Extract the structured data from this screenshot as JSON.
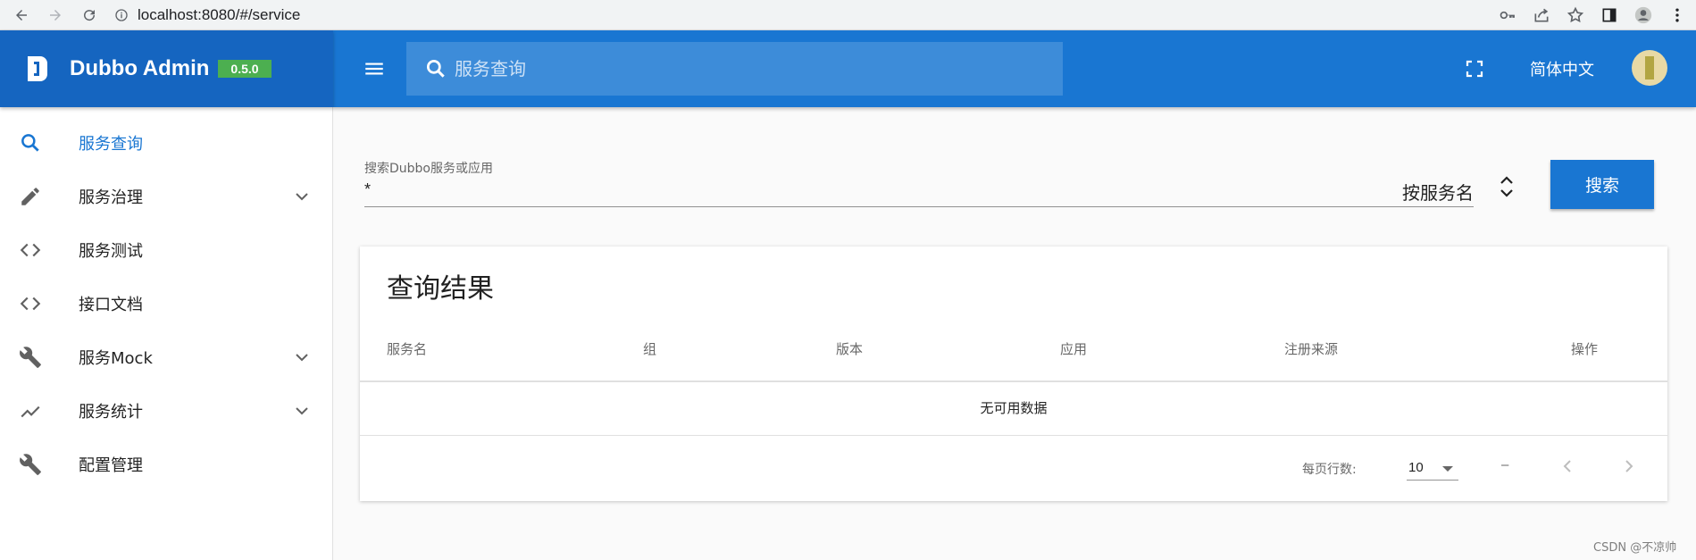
{
  "browser": {
    "url": "localhost:8080/#/service"
  },
  "header": {
    "app_title": "Dubbo Admin",
    "version": "0.5.0",
    "search_placeholder": "服务查询",
    "language": "简体中文"
  },
  "sidebar": {
    "items": [
      {
        "label": "服务查询",
        "icon": "search-icon",
        "active": true
      },
      {
        "label": "服务治理",
        "icon": "pencil-icon",
        "expandable": true
      },
      {
        "label": "服务测试",
        "icon": "code-icon"
      },
      {
        "label": "接口文档",
        "icon": "code-icon"
      },
      {
        "label": "服务Mock",
        "icon": "wrench-icon",
        "expandable": true
      },
      {
        "label": "服务统计",
        "icon": "trending-up-icon",
        "expandable": true
      },
      {
        "label": "配置管理",
        "icon": "wrench-icon"
      }
    ]
  },
  "search": {
    "label": "搜索Dubbo服务或应用",
    "value": "*",
    "mode": "按服务名",
    "button": "搜索"
  },
  "results": {
    "title": "查询结果",
    "columns": [
      "服务名",
      "组",
      "版本",
      "应用",
      "注册来源",
      "操作"
    ],
    "empty_text": "无可用数据",
    "rows_per_page_label": "每页行数:",
    "rows_per_page": "10",
    "page_info": "–"
  },
  "watermark": "CSDN @不凉帅",
  "colors": {
    "primary": "#1976d2",
    "sidebar_header": "#1565c0",
    "version_chip": "#4caf50"
  }
}
